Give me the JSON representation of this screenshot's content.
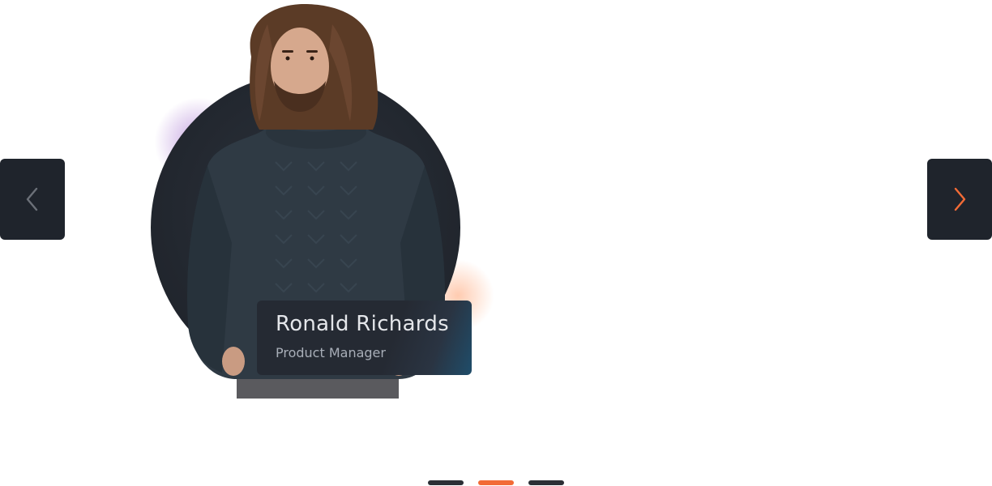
{
  "colors": {
    "accent": "#f26b36",
    "nav_bg": "#1f242c",
    "card_bg": "#252a33",
    "dot_inactive": "#2b2f35",
    "prev_arrow": "#6b7078"
  },
  "nav": {
    "prev_icon": "chevron-left-icon",
    "next_icon": "chevron-right-icon"
  },
  "profile": {
    "name": "Ronald Richards",
    "role": "Product Manager"
  },
  "pagination": {
    "total": 3,
    "active_index": 1
  }
}
